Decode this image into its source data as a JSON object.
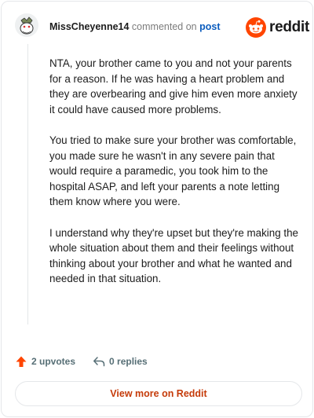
{
  "header": {
    "username": "MissCheyenne14",
    "action_text": "commented on",
    "link_text": "post",
    "brand": "reddit"
  },
  "comment": {
    "paragraphs": [
      "NTA, your brother came to you and not your parents for a reason. If he was having a heart problem and they are overbearing and give him even more anxiety it could have caused more problems.",
      "You tried to make sure your brother was comfortable, you made sure he wasn't in any severe pain that would require a paramedic, you took him to the hospital ASAP, and left your parents a note letting them know where you were.",
      "I understand why they're upset but they're making the whole situation about them and their feelings without thinking about your brother and what he wanted and needed in that situation."
    ]
  },
  "actions": {
    "upvotes": "2 upvotes",
    "replies": "0 replies"
  },
  "footer": {
    "view_more_label": "View more on Reddit"
  },
  "colors": {
    "reddit_orange": "#ff4500",
    "link_blue": "#0b5cbe",
    "view_more_text": "#c53b0a",
    "muted": "#576f76"
  },
  "icons": {
    "avatar": "snoo-avatar-icon",
    "logo": "reddit-snoo-icon",
    "upvote": "upvote-arrow-icon",
    "reply": "reply-arrow-icon"
  }
}
